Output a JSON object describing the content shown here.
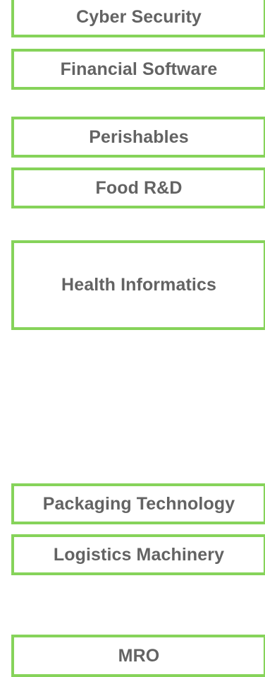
{
  "boxes": [
    {
      "label": "Cyber Security"
    },
    {
      "label": "Financial Software"
    },
    {
      "label": "Perishables"
    },
    {
      "label": "Food R&D"
    },
    {
      "label": "Health Informatics"
    },
    {
      "label": "Packaging Technology"
    },
    {
      "label": "Logistics Machinery"
    },
    {
      "label": "MRO"
    }
  ],
  "colors": {
    "border": "#86d35a",
    "text": "#636363",
    "background": "#ffffff"
  }
}
